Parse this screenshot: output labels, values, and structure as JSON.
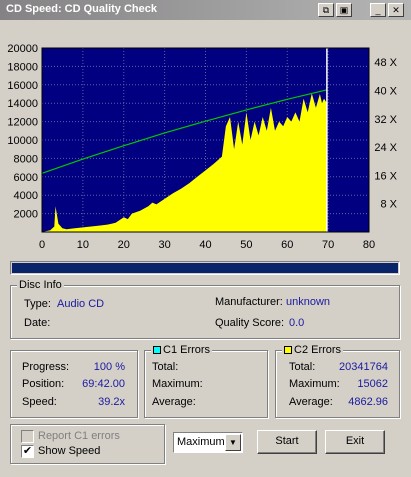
{
  "window": {
    "title": "CD Speed: CD Quality Check"
  },
  "titlebar_buttons": [
    {
      "name": "copy-icon",
      "glyph": "⧉"
    },
    {
      "name": "save-icon",
      "glyph": "▣"
    },
    {
      "name": "minimize-icon",
      "glyph": "_"
    },
    {
      "name": "close-icon",
      "glyph": "✕"
    }
  ],
  "chart_data": {
    "type": "area",
    "x_ticks": [
      0,
      10,
      20,
      30,
      40,
      50,
      60,
      70,
      80
    ],
    "y_left_ticks": [
      2000,
      4000,
      6000,
      8000,
      10000,
      12000,
      14000,
      16000,
      18000,
      20000
    ],
    "y_right_ticks": [
      "8 X",
      "16 X",
      "24 X",
      "32 X",
      "40 X",
      "48 X"
    ],
    "xlim": [
      0,
      80
    ],
    "ylim_left": [
      0,
      20000
    ],
    "ylim_right": [
      0,
      52
    ],
    "grid": true,
    "end_position_min": 69.7,
    "series": [
      {
        "kind": "area",
        "color": "#ffff00",
        "x": [
          0,
          2,
          3,
          3.3,
          4,
          5,
          6,
          8,
          10,
          12,
          14,
          16,
          17,
          18,
          19,
          20,
          21,
          22,
          24,
          26,
          27,
          28,
          30,
          32,
          34,
          36,
          38,
          40,
          42,
          44,
          45,
          46,
          47,
          48,
          49,
          50,
          51,
          52,
          53,
          54,
          55,
          56,
          57,
          58,
          59,
          60,
          61,
          62,
          63,
          64,
          65,
          66,
          67,
          68,
          68.5,
          69,
          69.7
        ],
        "y": [
          0,
          200,
          600,
          2800,
          900,
          400,
          300,
          400,
          500,
          600,
          700,
          800,
          900,
          1000,
          1300,
          1600,
          1400,
          2000,
          2300,
          2800,
          3200,
          3000,
          3600,
          4200,
          4700,
          5300,
          6000,
          6700,
          7400,
          8200,
          11500,
          12500,
          9000,
          12000,
          9500,
          13000,
          10000,
          12000,
          10500,
          12500,
          11000,
          13500,
          11000,
          12000,
          11500,
          12500,
          12000,
          13000,
          12000,
          14500,
          13000,
          15062,
          13500,
          15000,
          14000,
          14500,
          14000
        ]
      },
      {
        "kind": "line",
        "color": "#00c800",
        "axis": "right",
        "x": [
          0,
          10,
          20,
          30,
          40,
          50,
          60,
          69.7
        ],
        "y": [
          16.6,
          20.6,
          24.4,
          28,
          31.3,
          34.5,
          37.5,
          40.2
        ]
      }
    ]
  },
  "progress": {
    "fraction": 1.0
  },
  "disc_info": {
    "title": "Disc Info",
    "type_label": "Type:",
    "type_value": "Audio CD",
    "date_label": "Date:",
    "manufacturer_label": "Manufacturer:",
    "manufacturer_value": "unknown",
    "quality_label": "Quality Score:",
    "quality_value": "0.0"
  },
  "status": {
    "progress_label": "Progress:",
    "progress_value": "100 %",
    "position_label": "Position:",
    "position_value": "69:42.00",
    "speed_label": "Speed:",
    "speed_value": "39.2x"
  },
  "c1": {
    "title": "C1 Errors",
    "color": "#00ffff",
    "total_label": "Total:",
    "max_label": "Maximum:",
    "avg_label": "Average:"
  },
  "c2": {
    "title": "C2 Errors",
    "color": "#ffff00",
    "total_label": "Total:",
    "total_value": "20341764",
    "max_label": "Maximum:",
    "max_value": "15062",
    "avg_label": "Average:",
    "avg_value": "4862.96"
  },
  "options": {
    "report_c1_label": "Report C1 errors",
    "report_c1_checked": false,
    "show_speed_label": "Show Speed",
    "show_speed_checked": true,
    "mode_select": "Maximum"
  },
  "buttons": {
    "start": "Start",
    "exit": "Exit"
  }
}
